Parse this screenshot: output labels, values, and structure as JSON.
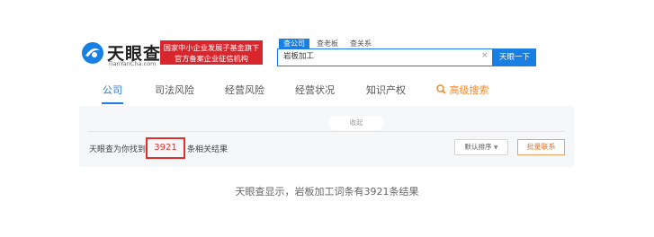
{
  "brand": {
    "name": "天眼查",
    "domain": "TianYanCha.com",
    "banner_line1": "国家中小企业发展子基金旗下",
    "banner_line2": "官方备案企业征信机构"
  },
  "search": {
    "tabs": [
      "查公司",
      "查老板",
      "查关系"
    ],
    "value": "岩板加工",
    "clear_glyph": "×",
    "button_label": "天眼一下"
  },
  "nav": {
    "items": [
      "公司",
      "司法风险",
      "经营风险",
      "经营状况",
      "知识产权"
    ],
    "advanced_label": "高级搜索"
  },
  "results": {
    "collapse_label": "收起",
    "prefix": "天眼查为你找到",
    "count": "3921",
    "suffix": "条相关结果",
    "sort_label": "默认排序",
    "contact_label": "批量联系"
  },
  "caption": "天眼查显示，岩板加工词条有3921条结果",
  "colors": {
    "accent": "#1a7fe3",
    "banner": "#d9262c",
    "highlight": "#e0302b",
    "orange": "#f5861f"
  }
}
